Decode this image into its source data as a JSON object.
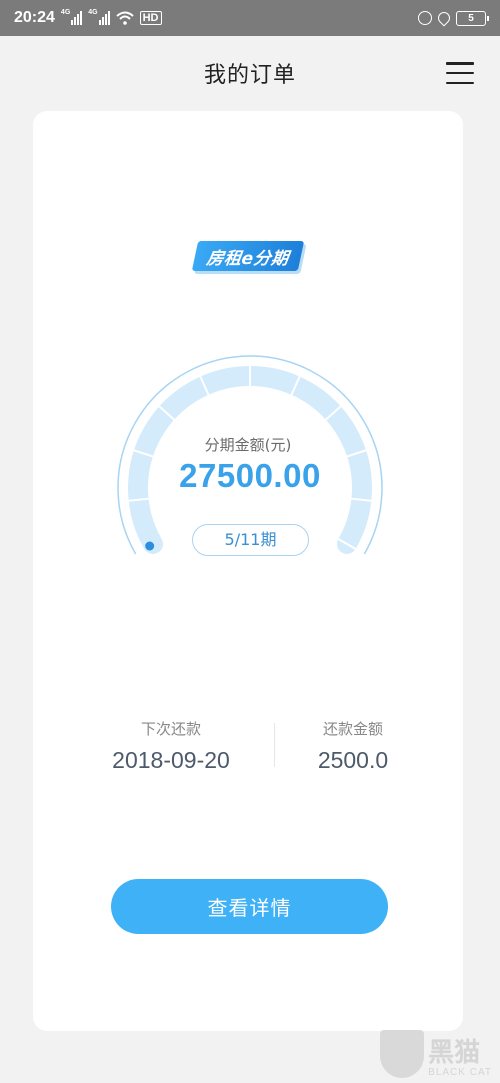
{
  "status_bar": {
    "time": "20:24",
    "net1": "4G",
    "net2": "4G",
    "hd": "HD",
    "battery": "5",
    "icons": [
      "signal-icon",
      "wifi-icon",
      "hd-icon",
      "lock-circle-icon",
      "location-icon",
      "battery-icon"
    ]
  },
  "header": {
    "title": "我的订单",
    "menu_icon": "hamburger-menu-icon"
  },
  "card": {
    "logo_text": "房租e分期",
    "gauge": {
      "label": "分期金额(元)",
      "amount": "27500.00",
      "period": "5/11期",
      "progress": 0.4545
    },
    "next_payment": {
      "label": "下次还款",
      "value": "2018-09-20"
    },
    "payment_amount": {
      "label": "还款金额",
      "value": "2500.0"
    },
    "detail_button": "查看详情"
  },
  "watermark": {
    "cn": "黑猫",
    "en": "BLACK CAT"
  },
  "colors": {
    "accent": "#3fb1f6",
    "amount": "#3aa2ea",
    "gauge_track": "#d4ebfb",
    "gauge_fill": "#b3dcf7"
  }
}
